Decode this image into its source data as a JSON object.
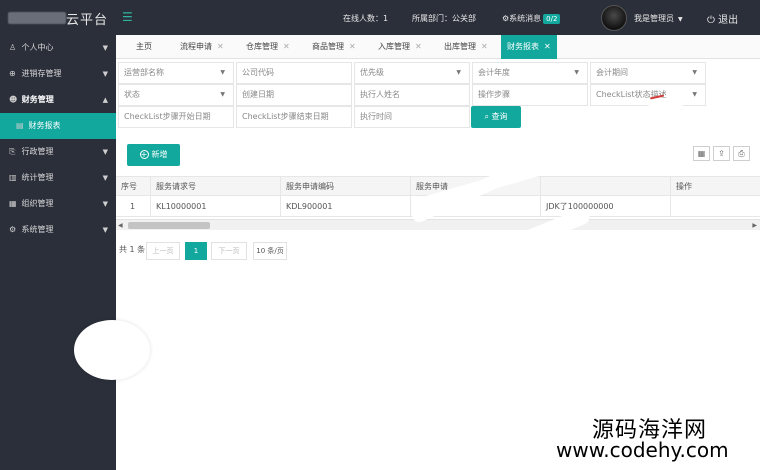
{
  "brand": {
    "title": "云平台"
  },
  "topbar": {
    "online": "在线人数：1",
    "department": "所属部门：公关部",
    "messages_label": "系统消息",
    "messages_badge": "0/2",
    "user": "我是管理员",
    "logout": "退出"
  },
  "sidebar": {
    "items": [
      {
        "label": "个人中心",
        "icon": "user-icon"
      },
      {
        "label": "进销存管理",
        "icon": "inventory-icon"
      },
      {
        "label": "财务管理",
        "icon": "finance-icon"
      },
      {
        "label": "财务报表",
        "icon": "report-icon"
      },
      {
        "label": "行政管理",
        "icon": "admin-icon"
      },
      {
        "label": "统计管理",
        "icon": "stats-icon"
      },
      {
        "label": "组织管理",
        "icon": "org-icon"
      },
      {
        "label": "系统管理",
        "icon": "gear-icon"
      }
    ]
  },
  "tabs": [
    {
      "label": "主页"
    },
    {
      "label": "流程申请"
    },
    {
      "label": "仓库管理"
    },
    {
      "label": "商品管理"
    },
    {
      "label": "入库管理"
    },
    {
      "label": "出库管理"
    },
    {
      "label": "财务报表"
    }
  ],
  "filters": {
    "row1": [
      "运营部名称",
      "公司代码",
      "优先级",
      "会计年度",
      "会计期间"
    ],
    "row2": [
      "状态",
      "创建日期",
      "执行人姓名",
      "操作步骤",
      "CheckList状态描述"
    ],
    "row3": [
      "CheckList步骤开始日期",
      "CheckList步骤结束日期",
      "执行时间"
    ],
    "search_label": "查询"
  },
  "toolbar": {
    "add_label": "新增"
  },
  "table": {
    "headers": [
      "序号",
      "服务请求号",
      "服务申请编码",
      "服务申请",
      "",
      "操作"
    ],
    "rows": [
      [
        "1",
        "KL10000001",
        "KDL900001",
        "",
        "JDK了100000000",
        ""
      ]
    ]
  },
  "pagination": {
    "total": "共 1 条",
    "prev": "上一页",
    "current": "1",
    "next": "下一页",
    "page_size": "10 条/页"
  },
  "watermark": {
    "line1": "源码海洋网",
    "line2": "www.codehy.com"
  },
  "colors": {
    "accent": "#13a89e",
    "sidebar_bg": "#2b2f3a"
  }
}
